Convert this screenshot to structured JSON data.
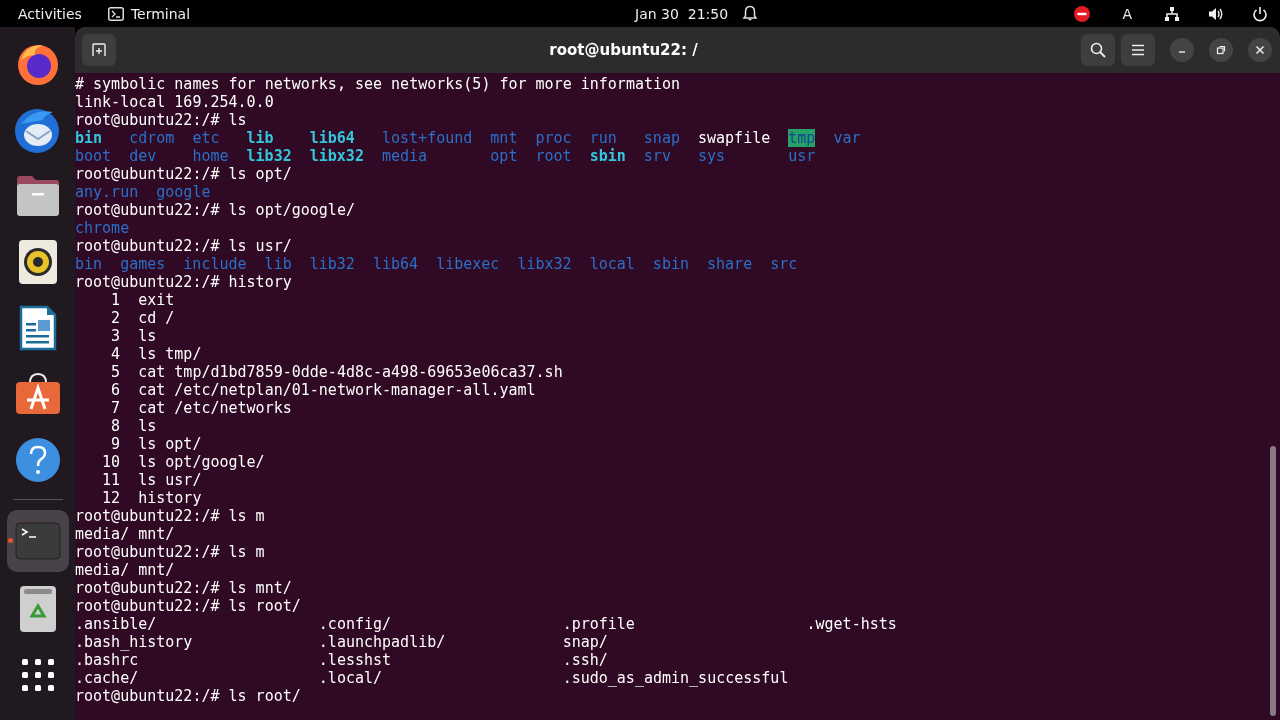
{
  "top_bar": {
    "activities": "Activities",
    "app": "Terminal",
    "date": "Jan 30",
    "time": "21:50",
    "keyboard": "A"
  },
  "dock": {
    "items": [
      {
        "kind": "firefox",
        "running": false
      },
      {
        "kind": "thunderbird",
        "running": false
      },
      {
        "kind": "files",
        "running": false
      },
      {
        "kind": "rhythmbox",
        "running": false
      },
      {
        "kind": "writer",
        "running": false
      },
      {
        "kind": "appcenter",
        "running": false
      },
      {
        "kind": "help",
        "running": false
      },
      {
        "kind": "separator"
      },
      {
        "kind": "terminal",
        "running": true
      },
      {
        "kind": "trash",
        "running": false
      },
      {
        "kind": "grid",
        "running": false
      }
    ]
  },
  "window": {
    "title": "root@ubuntu22: /"
  },
  "terminal": {
    "lines": [
      {
        "kind": "text",
        "text": "# symbolic names for networks, see networks(5) for more information"
      },
      {
        "kind": "text",
        "text": "link-local 169.254.0.0"
      },
      {
        "kind": "text",
        "text": "root@ubuntu22:/# ls"
      },
      {
        "kind": "grid",
        "rows": [
          [
            {
              "name": "bin",
              "kind": "link"
            },
            {
              "name": "cdrom",
              "kind": "dir"
            },
            {
              "name": "etc",
              "kind": "dir"
            },
            {
              "name": "lib",
              "kind": "link"
            },
            {
              "name": "lib64",
              "kind": "link"
            },
            {
              "name": "lost+found",
              "kind": "dir"
            },
            {
              "name": "mnt",
              "kind": "dir"
            },
            {
              "name": "proc",
              "kind": "dir"
            },
            {
              "name": "run",
              "kind": "dir"
            },
            {
              "name": "snap",
              "kind": "dir"
            },
            {
              "name": "swapfile",
              "kind": "file"
            },
            {
              "name": "tmp",
              "kind": "sticky"
            },
            {
              "name": "var",
              "kind": "dir"
            }
          ],
          [
            {
              "name": "boot",
              "kind": "dir"
            },
            {
              "name": "dev",
              "kind": "dir"
            },
            {
              "name": "home",
              "kind": "dir"
            },
            {
              "name": "lib32",
              "kind": "link"
            },
            {
              "name": "libx32",
              "kind": "link"
            },
            {
              "name": "media",
              "kind": "dir"
            },
            {
              "name": "opt",
              "kind": "dir"
            },
            {
              "name": "root",
              "kind": "dir"
            },
            {
              "name": "sbin",
              "kind": "link"
            },
            {
              "name": "srv",
              "kind": "dir"
            },
            {
              "name": "sys",
              "kind": "dir"
            },
            {
              "name": "usr",
              "kind": "dir"
            }
          ]
        ]
      },
      {
        "kind": "text",
        "text": "root@ubuntu22:/# ls opt/"
      },
      {
        "kind": "grid",
        "rows": [
          [
            {
              "name": "any.run",
              "kind": "dir"
            },
            {
              "name": "google",
              "kind": "dir"
            }
          ]
        ]
      },
      {
        "kind": "text",
        "text": "root@ubuntu22:/# ls opt/google/"
      },
      {
        "kind": "grid",
        "rows": [
          [
            {
              "name": "chrome",
              "kind": "dir"
            }
          ]
        ]
      },
      {
        "kind": "text",
        "text": "root@ubuntu22:/# ls usr/"
      },
      {
        "kind": "grid",
        "rows": [
          [
            {
              "name": "bin",
              "kind": "dir"
            },
            {
              "name": "games",
              "kind": "dir"
            },
            {
              "name": "include",
              "kind": "dir"
            },
            {
              "name": "lib",
              "kind": "dir"
            },
            {
              "name": "lib32",
              "kind": "dir"
            },
            {
              "name": "lib64",
              "kind": "dir"
            },
            {
              "name": "libexec",
              "kind": "dir"
            },
            {
              "name": "libx32",
              "kind": "dir"
            },
            {
              "name": "local",
              "kind": "dir"
            },
            {
              "name": "sbin",
              "kind": "dir"
            },
            {
              "name": "share",
              "kind": "dir"
            },
            {
              "name": "src",
              "kind": "dir"
            }
          ]
        ]
      },
      {
        "kind": "text",
        "text": "root@ubuntu22:/# history"
      },
      {
        "kind": "text",
        "text": "    1  exit"
      },
      {
        "kind": "text",
        "text": "    2  cd /"
      },
      {
        "kind": "text",
        "text": "    3  ls"
      },
      {
        "kind": "text",
        "text": "    4  ls tmp/"
      },
      {
        "kind": "text",
        "text": "    5  cat tmp/d1bd7859-0dde-4d8c-a498-69653e06ca37.sh"
      },
      {
        "kind": "text",
        "text": "    6  cat /etc/netplan/01-network-manager-all.yaml"
      },
      {
        "kind": "text",
        "text": "    7  cat /etc/networks"
      },
      {
        "kind": "text",
        "text": "    8  ls"
      },
      {
        "kind": "text",
        "text": "    9  ls opt/"
      },
      {
        "kind": "text",
        "text": "   10  ls opt/google/"
      },
      {
        "kind": "text",
        "text": "   11  ls usr/"
      },
      {
        "kind": "text",
        "text": "   12  history"
      },
      {
        "kind": "text",
        "text": "root@ubuntu22:/# ls m"
      },
      {
        "kind": "text",
        "text": "media/ mnt/"
      },
      {
        "kind": "text",
        "text": "root@ubuntu22:/# ls m"
      },
      {
        "kind": "text",
        "text": "media/ mnt/"
      },
      {
        "kind": "text",
        "text": "root@ubuntu22:/# ls mnt/"
      },
      {
        "kind": "text",
        "text": "root@ubuntu22:/# ls root/"
      },
      {
        "kind": "grid_uniform",
        "rows": [
          [
            {
              "name": ".ansible/",
              "kind": "file"
            },
            {
              "name": ".config/",
              "kind": "file"
            },
            {
              "name": ".profile",
              "kind": "file"
            },
            {
              "name": ".wget-hsts",
              "kind": "file"
            }
          ],
          [
            {
              "name": ".bash_history",
              "kind": "file"
            },
            {
              "name": ".launchpadlib/",
              "kind": "file"
            },
            {
              "name": "snap/",
              "kind": "file"
            }
          ],
          [
            {
              "name": ".bashrc",
              "kind": "file"
            },
            {
              "name": ".lesshst",
              "kind": "file"
            },
            {
              "name": ".ssh/",
              "kind": "file"
            }
          ],
          [
            {
              "name": ".cache/",
              "kind": "file"
            },
            {
              "name": ".local/",
              "kind": "file"
            },
            {
              "name": ".sudo_as_admin_successful",
              "kind": "file"
            }
          ]
        ]
      },
      {
        "kind": "text",
        "text": "root@ubuntu22:/# ls root/"
      }
    ]
  }
}
